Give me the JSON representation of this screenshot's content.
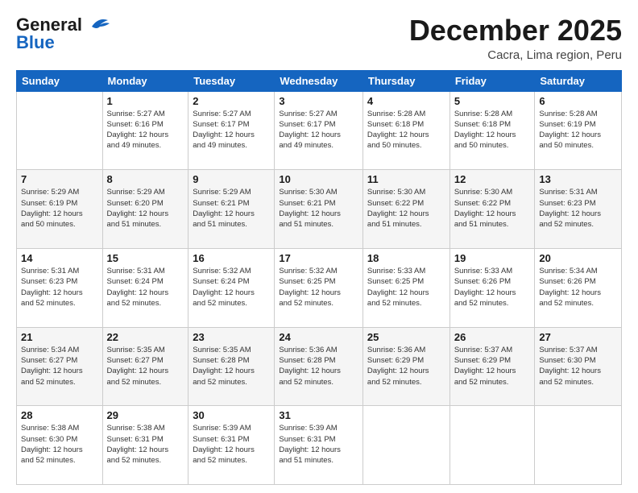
{
  "header": {
    "logo_line1": "General",
    "logo_line2": "Blue",
    "month": "December 2025",
    "location": "Cacra, Lima region, Peru"
  },
  "weekdays": [
    "Sunday",
    "Monday",
    "Tuesday",
    "Wednesday",
    "Thursday",
    "Friday",
    "Saturday"
  ],
  "weeks": [
    [
      {
        "day": "",
        "info": ""
      },
      {
        "day": "1",
        "info": "Sunrise: 5:27 AM\nSunset: 6:16 PM\nDaylight: 12 hours\nand 49 minutes."
      },
      {
        "day": "2",
        "info": "Sunrise: 5:27 AM\nSunset: 6:17 PM\nDaylight: 12 hours\nand 49 minutes."
      },
      {
        "day": "3",
        "info": "Sunrise: 5:27 AM\nSunset: 6:17 PM\nDaylight: 12 hours\nand 49 minutes."
      },
      {
        "day": "4",
        "info": "Sunrise: 5:28 AM\nSunset: 6:18 PM\nDaylight: 12 hours\nand 50 minutes."
      },
      {
        "day": "5",
        "info": "Sunrise: 5:28 AM\nSunset: 6:18 PM\nDaylight: 12 hours\nand 50 minutes."
      },
      {
        "day": "6",
        "info": "Sunrise: 5:28 AM\nSunset: 6:19 PM\nDaylight: 12 hours\nand 50 minutes."
      }
    ],
    [
      {
        "day": "7",
        "info": "Sunrise: 5:29 AM\nSunset: 6:19 PM\nDaylight: 12 hours\nand 50 minutes."
      },
      {
        "day": "8",
        "info": "Sunrise: 5:29 AM\nSunset: 6:20 PM\nDaylight: 12 hours\nand 51 minutes."
      },
      {
        "day": "9",
        "info": "Sunrise: 5:29 AM\nSunset: 6:21 PM\nDaylight: 12 hours\nand 51 minutes."
      },
      {
        "day": "10",
        "info": "Sunrise: 5:30 AM\nSunset: 6:21 PM\nDaylight: 12 hours\nand 51 minutes."
      },
      {
        "day": "11",
        "info": "Sunrise: 5:30 AM\nSunset: 6:22 PM\nDaylight: 12 hours\nand 51 minutes."
      },
      {
        "day": "12",
        "info": "Sunrise: 5:30 AM\nSunset: 6:22 PM\nDaylight: 12 hours\nand 51 minutes."
      },
      {
        "day": "13",
        "info": "Sunrise: 5:31 AM\nSunset: 6:23 PM\nDaylight: 12 hours\nand 52 minutes."
      }
    ],
    [
      {
        "day": "14",
        "info": "Sunrise: 5:31 AM\nSunset: 6:23 PM\nDaylight: 12 hours\nand 52 minutes."
      },
      {
        "day": "15",
        "info": "Sunrise: 5:31 AM\nSunset: 6:24 PM\nDaylight: 12 hours\nand 52 minutes."
      },
      {
        "day": "16",
        "info": "Sunrise: 5:32 AM\nSunset: 6:24 PM\nDaylight: 12 hours\nand 52 minutes."
      },
      {
        "day": "17",
        "info": "Sunrise: 5:32 AM\nSunset: 6:25 PM\nDaylight: 12 hours\nand 52 minutes."
      },
      {
        "day": "18",
        "info": "Sunrise: 5:33 AM\nSunset: 6:25 PM\nDaylight: 12 hours\nand 52 minutes."
      },
      {
        "day": "19",
        "info": "Sunrise: 5:33 AM\nSunset: 6:26 PM\nDaylight: 12 hours\nand 52 minutes."
      },
      {
        "day": "20",
        "info": "Sunrise: 5:34 AM\nSunset: 6:26 PM\nDaylight: 12 hours\nand 52 minutes."
      }
    ],
    [
      {
        "day": "21",
        "info": "Sunrise: 5:34 AM\nSunset: 6:27 PM\nDaylight: 12 hours\nand 52 minutes."
      },
      {
        "day": "22",
        "info": "Sunrise: 5:35 AM\nSunset: 6:27 PM\nDaylight: 12 hours\nand 52 minutes."
      },
      {
        "day": "23",
        "info": "Sunrise: 5:35 AM\nSunset: 6:28 PM\nDaylight: 12 hours\nand 52 minutes."
      },
      {
        "day": "24",
        "info": "Sunrise: 5:36 AM\nSunset: 6:28 PM\nDaylight: 12 hours\nand 52 minutes."
      },
      {
        "day": "25",
        "info": "Sunrise: 5:36 AM\nSunset: 6:29 PM\nDaylight: 12 hours\nand 52 minutes."
      },
      {
        "day": "26",
        "info": "Sunrise: 5:37 AM\nSunset: 6:29 PM\nDaylight: 12 hours\nand 52 minutes."
      },
      {
        "day": "27",
        "info": "Sunrise: 5:37 AM\nSunset: 6:30 PM\nDaylight: 12 hours\nand 52 minutes."
      }
    ],
    [
      {
        "day": "28",
        "info": "Sunrise: 5:38 AM\nSunset: 6:30 PM\nDaylight: 12 hours\nand 52 minutes."
      },
      {
        "day": "29",
        "info": "Sunrise: 5:38 AM\nSunset: 6:31 PM\nDaylight: 12 hours\nand 52 minutes."
      },
      {
        "day": "30",
        "info": "Sunrise: 5:39 AM\nSunset: 6:31 PM\nDaylight: 12 hours\nand 52 minutes."
      },
      {
        "day": "31",
        "info": "Sunrise: 5:39 AM\nSunset: 6:31 PM\nDaylight: 12 hours\nand 51 minutes."
      },
      {
        "day": "",
        "info": ""
      },
      {
        "day": "",
        "info": ""
      },
      {
        "day": "",
        "info": ""
      }
    ]
  ]
}
